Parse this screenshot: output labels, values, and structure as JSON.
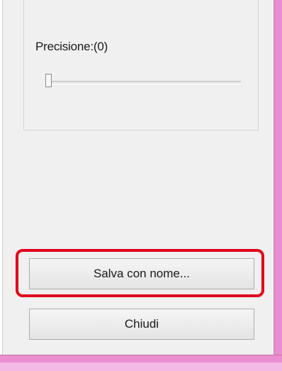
{
  "precision": {
    "label": "Precisione:(0)",
    "value": 0
  },
  "buttons": {
    "save_as_label": "Salva con nome...",
    "close_label": "Chiudi"
  },
  "colors": {
    "panel_background": "#f0f0f0",
    "window_frame": "#e98fd0",
    "highlight": "#e0001b"
  }
}
